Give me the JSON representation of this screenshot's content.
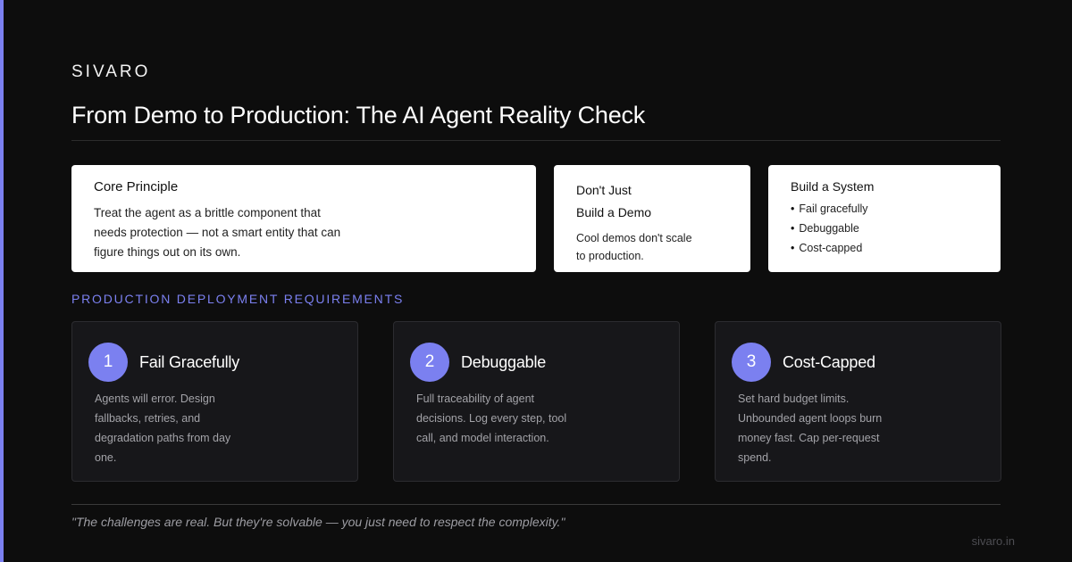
{
  "brand": "SIVARO",
  "title": "From Demo to Production: The AI Agent Reality Check",
  "cards": {
    "principle": {
      "title": "Core Principle",
      "body": "Treat the agent as a brittle component that needs protection — not a smart entity that can figure things out on its own."
    },
    "demo": {
      "title_line1": "Don't Just",
      "title_line2": "Build a Demo",
      "body": "Cool demos don't scale to production."
    },
    "system": {
      "title": "Build a System",
      "items": [
        "Fail gracefully",
        "Debuggable",
        "Cost-capped"
      ]
    }
  },
  "section_label": "PRODUCTION DEPLOYMENT REQUIREMENTS",
  "requirements": [
    {
      "number": "1",
      "title": "Fail Gracefully",
      "body": "Agents will error. Design fallbacks, retries, and degradation paths from day one."
    },
    {
      "number": "2",
      "title": "Debuggable",
      "body": "Full traceability of agent decisions. Log every step, tool call, and model interaction."
    },
    {
      "number": "3",
      "title": "Cost-Capped",
      "body": "Set hard budget limits. Unbounded agent loops burn money fast. Cap per-request spend."
    }
  ],
  "quote": "\"The challenges are real. But they're solvable — you just need to respect the complexity.\"",
  "site": "sivaro.in",
  "colors": {
    "accent": "#7b80f0",
    "background": "#0d0d0d",
    "card_white": "#ffffff",
    "requirement_bg": "#17171a"
  }
}
